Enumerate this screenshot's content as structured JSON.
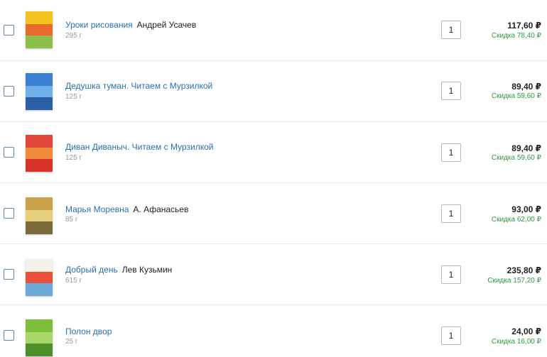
{
  "currency": "₽",
  "discount_prefix": "Скидка",
  "items": [
    {
      "title": "Уроки рисования",
      "author": "Андрей Усачев",
      "weight": "295 г",
      "quantity": "1",
      "price": "117,60 ₽",
      "discount": "Скидка 78,40 ₽",
      "cover_colors": [
        "#f2c21e",
        "#e86a2a",
        "#8bbf4a"
      ]
    },
    {
      "title": "Дедушка туман. Читаем с Мурзилкой",
      "author": "",
      "weight": "125 г",
      "quantity": "1",
      "price": "89,40 ₽",
      "discount": "Скидка 59,60 ₽",
      "cover_colors": [
        "#3a7fd0",
        "#6fb0e8",
        "#2d5fa8"
      ]
    },
    {
      "title": "Диван Диваныч. Читаем с Мурзилкой",
      "author": "",
      "weight": "125 г",
      "quantity": "1",
      "price": "89,40 ₽",
      "discount": "Скидка 59,60 ₽",
      "cover_colors": [
        "#e2463a",
        "#f08a3c",
        "#d83328"
      ]
    },
    {
      "title": "Марья Моревна",
      "author": "А. Афанасьев",
      "weight": "85 г",
      "quantity": "1",
      "price": "93,00 ₽",
      "discount": "Скидка 62,00 ₽",
      "cover_colors": [
        "#c9a24a",
        "#e6cf7a",
        "#7a6a3a"
      ]
    },
    {
      "title": "Добрый день",
      "author": "Лев Кузьмин",
      "weight": "615 г",
      "quantity": "1",
      "price": "235,80 ₽",
      "discount": "Скидка 157,20 ₽",
      "cover_colors": [
        "#f4f0ea",
        "#e8503a",
        "#6aa8d8"
      ]
    },
    {
      "title": "Полон двор",
      "author": "",
      "weight": "25 г",
      "quantity": "1",
      "price": "24,00 ₽",
      "discount": "Скидка 16,00 ₽",
      "cover_colors": [
        "#7cbf3a",
        "#a8d86a",
        "#4f8f2a"
      ]
    }
  ]
}
